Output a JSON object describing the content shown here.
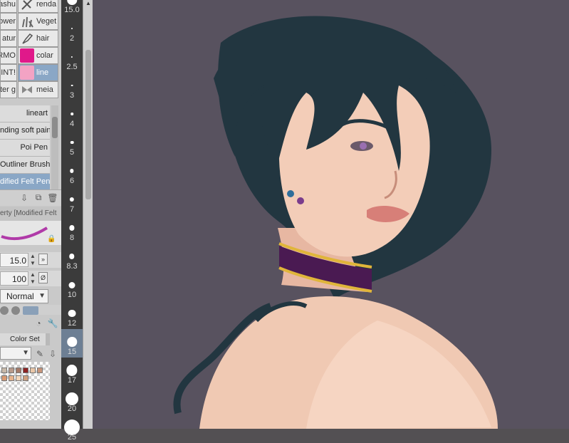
{
  "sub_tools": [
    {
      "left": "ashu",
      "right": "renda",
      "icon": "brush-stroke-icon"
    },
    {
      "left": "ower",
      "right": "Veget",
      "icon": "grass-icon"
    },
    {
      "left": "atur",
      "right": "hair",
      "icon": "pen-nib-icon"
    },
    {
      "left": "RMO",
      "right": "colar",
      "icon": "pink-swatch-icon"
    },
    {
      "left": "INT!",
      "right": "line",
      "icon": "rose-swatch-icon"
    },
    {
      "left": "iter g",
      "right": "meia",
      "icon": "bow-icon"
    }
  ],
  "brushes": [
    "lineart",
    "nding soft paint",
    "Poi Pen",
    "Outliner Brush",
    "dified Felt Pen"
  ],
  "active_brush_index": 4,
  "active_sub_tool_index": 4,
  "tool_property": {
    "header": "erty [Modified Felt",
    "brush_size": "15.0",
    "opacity": "100",
    "blend_mode": "Normal"
  },
  "color_set": {
    "tab_label": "Color Set",
    "swatches": [
      "#c7b9a9",
      "#b89a8a",
      "#a57a68",
      "#8d2323",
      "#e9c7a8",
      "#c8957a",
      "#d99a73",
      "#e7b38c",
      "#f2d5b9",
      "#cfa07e"
    ]
  },
  "brush_sizes": [
    "15.0",
    "2",
    "2.5",
    "3",
    "4",
    "5",
    "6",
    "7",
    "8",
    "8.3",
    "10",
    "12",
    "15",
    "17",
    "20",
    "25"
  ],
  "active_size": "15",
  "colors": {
    "canvas_bg": "#58525f",
    "hair": "#223640",
    "skin": "#f3cdb8",
    "choker": "#4a1a52",
    "gold": "#e0b53a",
    "accent_active": "#8aa7c6"
  }
}
